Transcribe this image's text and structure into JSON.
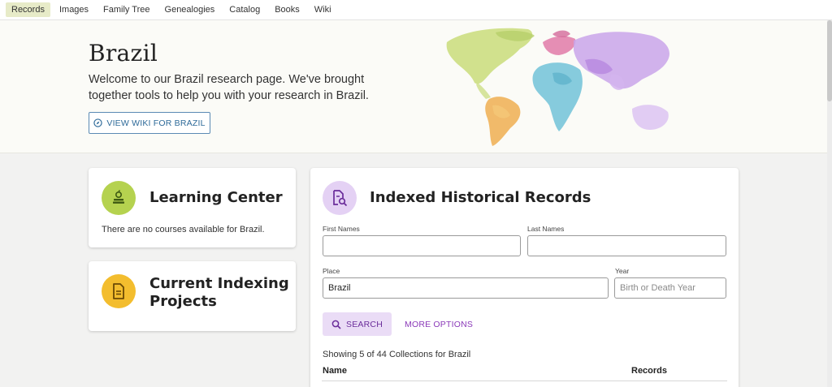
{
  "nav": {
    "tabs": [
      {
        "label": "Records",
        "active": true
      },
      {
        "label": "Images",
        "active": false
      },
      {
        "label": "Family Tree",
        "active": false
      },
      {
        "label": "Genealogies",
        "active": false
      },
      {
        "label": "Catalog",
        "active": false
      },
      {
        "label": "Books",
        "active": false
      },
      {
        "label": "Wiki",
        "active": false
      }
    ]
  },
  "hero": {
    "title": "Brazil",
    "description": "Welcome to our Brazil research page. We've brought together tools to help you with your research in Brazil.",
    "wiki_button": "VIEW WIKI FOR BRAZIL"
  },
  "learning": {
    "title": "Learning Center",
    "text": "There are no courses available for Brazil.",
    "icon": "learning-book-icon",
    "icon_bg": "#b5d24f"
  },
  "indexing": {
    "title_line1": "Current Indexing",
    "title_line2": "Projects",
    "icon": "document-icon",
    "icon_bg": "#f3bd2e"
  },
  "records": {
    "title": "Indexed Historical Records",
    "icon": "document-search-icon",
    "icon_bg": "#e4d1f4",
    "first_names_label": "First Names",
    "first_names_value": "",
    "last_names_label": "Last Names",
    "last_names_value": "",
    "place_label": "Place",
    "place_value": "Brazil",
    "year_label": "Year",
    "year_placeholder": "Birth or Death Year",
    "search_button": "SEARCH",
    "more_options": "MORE OPTIONS",
    "showing": "Showing 5 of 44 Collections for Brazil",
    "col_name": "Name",
    "col_records": "Records"
  },
  "colors": {
    "accent_purple": "#8b3ab9",
    "wiki_blue": "#2e6a99",
    "active_tab_bg": "#e7ebc8"
  }
}
